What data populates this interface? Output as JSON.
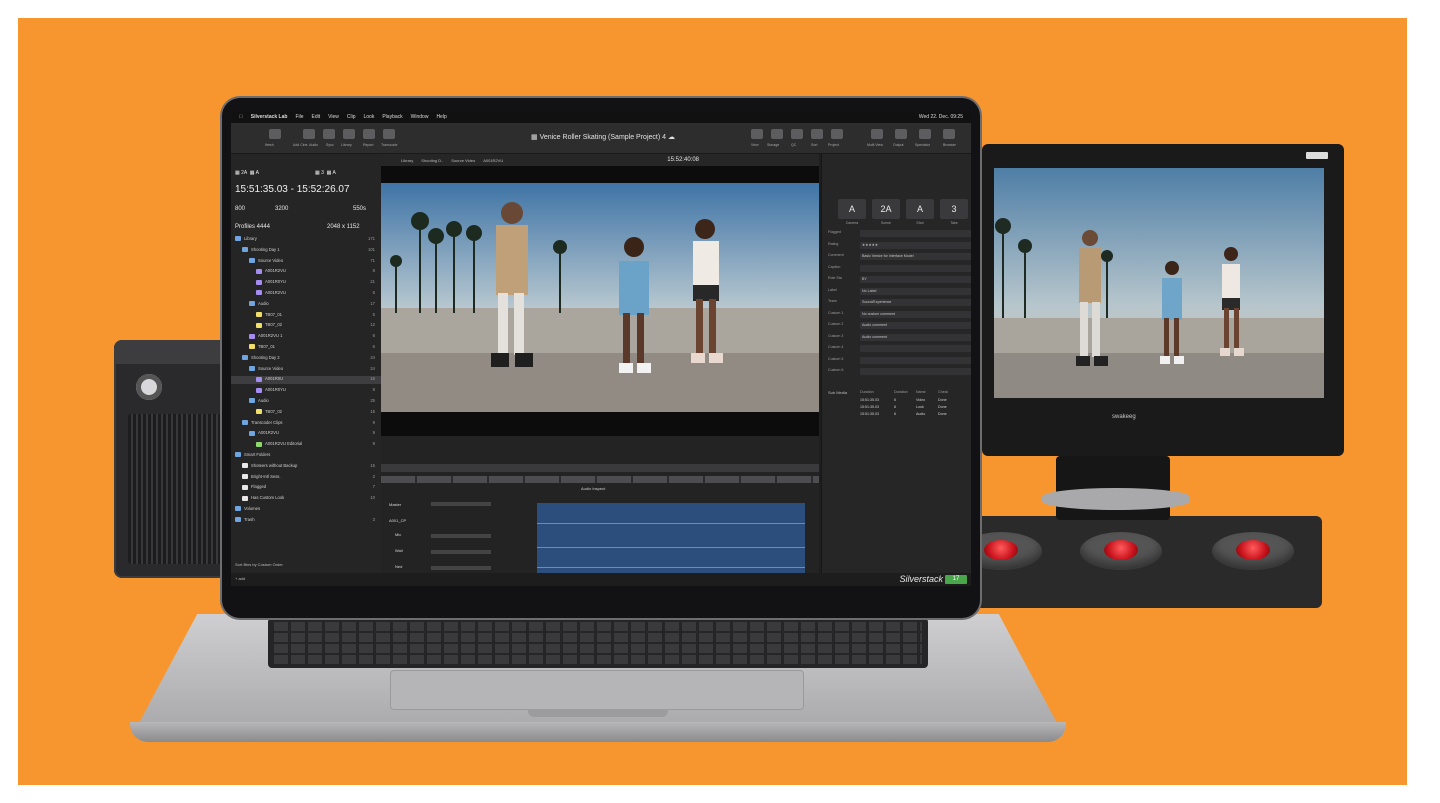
{
  "app": {
    "name": "Silverstack Lab",
    "menu": [
      "File",
      "Edit",
      "View",
      "Clip",
      "Look",
      "Playback",
      "Window",
      "Help"
    ],
    "clock": "Wed 22. Dec. 09:25",
    "project_title": "Venice Roller Skating (Sample Project) 4",
    "toolbar_left": [
      "Ifresh",
      "Add Cine. Audio",
      "Sync",
      "Library",
      "Report",
      "Transcode"
    ],
    "toolbar_right": [
      "View",
      "Storage",
      "QC",
      "Sort",
      "Project",
      "Multi View",
      "Output",
      "Spectator",
      "Browser"
    ]
  },
  "viewer": {
    "tabs": [
      "Library",
      "Shooting D..",
      "Source Video",
      "A001R2VU"
    ],
    "timecode": "15:52:40:08"
  },
  "sidebar": {
    "cameras": [
      "2A",
      "A",
      "3",
      "A"
    ],
    "tc_range": "15:51:35.03 - 15:52:26.07",
    "iso": "800",
    "kelvin": "3200",
    "shutter": "550s",
    "codec": "Profiles 4444",
    "resolution": "2048 x 1152",
    "tree": [
      {
        "label": "Library",
        "count": "171",
        "level": 0,
        "color": "#6fa5e0"
      },
      {
        "label": "Shooting Day 1",
        "count": "101",
        "level": 1,
        "color": "#6fa5e0"
      },
      {
        "label": "Source Video",
        "count": "71",
        "level": 2,
        "color": "#6fa5e0"
      },
      {
        "label": "A001R2VU",
        "count": "8",
        "level": 3,
        "color": "#a58cf0"
      },
      {
        "label": "A001R0YU",
        "count": "21",
        "level": 3,
        "color": "#a58cf0"
      },
      {
        "label": "A001R2VU",
        "count": "6",
        "level": 3,
        "color": "#a58cf0"
      },
      {
        "label": "Audio",
        "count": "17",
        "level": 2,
        "color": "#6fa5e0"
      },
      {
        "label": "TB07_01",
        "count": "5",
        "level": 3,
        "color": "#f1df6a"
      },
      {
        "label": "TB07_02",
        "count": "12",
        "level": 3,
        "color": "#f1df6a"
      },
      {
        "label": "A001R2VU 1",
        "count": "6",
        "level": 2,
        "color": "#a58cf0"
      },
      {
        "label": "TB07_01",
        "count": "6",
        "level": 2,
        "color": "#f1df6a"
      },
      {
        "label": "Shooting Day 2",
        "count": "24",
        "level": 1,
        "color": "#6fa5e0"
      },
      {
        "label": "Source Video",
        "count": "24",
        "level": 2,
        "color": "#6fa5e0"
      },
      {
        "label": "A001R0U",
        "count": "16",
        "level": 3,
        "color": "#a58cf0",
        "selected": true
      },
      {
        "label": "A001R0YU",
        "count": "8",
        "level": 3,
        "color": "#a58cf0"
      },
      {
        "label": "Audio",
        "count": "25",
        "level": 2,
        "color": "#6fa5e0"
      },
      {
        "label": "TB07_02",
        "count": "15",
        "level": 3,
        "color": "#f1df6a"
      },
      {
        "label": "Transcoder Clips",
        "count": "9",
        "level": 1,
        "color": "#6fa5e0"
      },
      {
        "label": "A001R2VU",
        "count": "9",
        "level": 2,
        "color": "#6fa5e0"
      },
      {
        "label": "A001R2VU Editorial",
        "count": "9",
        "level": 3,
        "color": "#8fd86b"
      },
      {
        "label": "Smart Folders",
        "count": "",
        "level": 0,
        "color": "#6fa5e0"
      },
      {
        "label": "Shoteers without Backup",
        "count": "15",
        "level": 1,
        "color": "#e8e8e8"
      },
      {
        "label": "Bright-Intl Sess.",
        "count": "2",
        "level": 1,
        "color": "#e8e8e8"
      },
      {
        "label": "Flagged",
        "count": "7",
        "level": 1,
        "color": "#e8e8e8"
      },
      {
        "label": "Has Custom Look",
        "count": "10",
        "level": 1,
        "color": "#e8e8e8"
      },
      {
        "label": "Volumes",
        "count": "",
        "level": 0,
        "color": "#6fa5e0"
      },
      {
        "label": "Trash",
        "count": "3",
        "level": 0,
        "color": "#6fa5e0"
      }
    ],
    "sort_label": "Sort Bins by Custom Order",
    "footer": "+ add"
  },
  "inspector": {
    "cells": [
      {
        "value": "A",
        "label": "Camera"
      },
      {
        "value": "2A",
        "label": "Scene"
      },
      {
        "value": "A",
        "label": "Shot"
      },
      {
        "value": "3",
        "label": "Take"
      }
    ],
    "fields": [
      {
        "label": "Flagged",
        "value": ""
      },
      {
        "label": "Rating",
        "value": "★★★★★"
      },
      {
        "label": "Comment",
        "value": "Basic Venice for Interface Model"
      },
      {
        "label": "Caption",
        "value": ""
      },
      {
        "label": "Role Sta",
        "value": "BY"
      },
      {
        "label": "Label",
        "value": "No Label"
      },
      {
        "label": "Team",
        "value": "Sound/Experience"
      },
      {
        "label": "Custom 1",
        "value": "No custom comment"
      },
      {
        "label": "Custom 2",
        "value": "Audio comment"
      },
      {
        "label": "Custom 3",
        "value": "Audio comment"
      },
      {
        "label": "Custom 4",
        "value": ""
      },
      {
        "label": "Custom 5",
        "value": ""
      },
      {
        "label": "Custom 6",
        "value": ""
      }
    ],
    "table_title": "Sub Media",
    "table_headers": [
      "Duration",
      "Duration",
      "Name",
      "Check"
    ],
    "table_rows": [
      [
        "15:51:35.03",
        "6",
        "Video",
        "Done"
      ],
      [
        "15:51:35.03",
        "6",
        "Look",
        "Done"
      ],
      [
        "15:51:35.03",
        "6",
        "Audio",
        "Done"
      ]
    ]
  },
  "timeline": {
    "tracks": [
      "Master",
      "A001_CP",
      "Mic",
      "Wall",
      "Ned"
    ],
    "mode": "Audio Inspect"
  },
  "statusbar": {
    "brand": "Silverstack",
    "badge": "17"
  },
  "monitor": {
    "logo": "swakeeg"
  }
}
